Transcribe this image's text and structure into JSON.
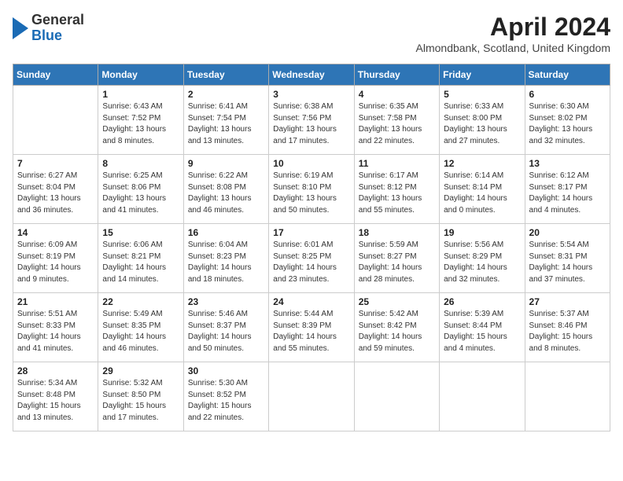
{
  "header": {
    "logo": {
      "line1": "General",
      "line2": "Blue"
    },
    "title": "April 2024",
    "location": "Almondbank, Scotland, United Kingdom"
  },
  "days_of_week": [
    "Sunday",
    "Monday",
    "Tuesday",
    "Wednesday",
    "Thursday",
    "Friday",
    "Saturday"
  ],
  "weeks": [
    [
      {
        "day": "",
        "sunrise": "",
        "sunset": "",
        "daylight": ""
      },
      {
        "day": "1",
        "sunrise": "6:43 AM",
        "sunset": "7:52 PM",
        "daylight": "13 hours and 8 minutes."
      },
      {
        "day": "2",
        "sunrise": "6:41 AM",
        "sunset": "7:54 PM",
        "daylight": "13 hours and 13 minutes."
      },
      {
        "day": "3",
        "sunrise": "6:38 AM",
        "sunset": "7:56 PM",
        "daylight": "13 hours and 17 minutes."
      },
      {
        "day": "4",
        "sunrise": "6:35 AM",
        "sunset": "7:58 PM",
        "daylight": "13 hours and 22 minutes."
      },
      {
        "day": "5",
        "sunrise": "6:33 AM",
        "sunset": "8:00 PM",
        "daylight": "13 hours and 27 minutes."
      },
      {
        "day": "6",
        "sunrise": "6:30 AM",
        "sunset": "8:02 PM",
        "daylight": "13 hours and 32 minutes."
      }
    ],
    [
      {
        "day": "7",
        "sunrise": "6:27 AM",
        "sunset": "8:04 PM",
        "daylight": "13 hours and 36 minutes."
      },
      {
        "day": "8",
        "sunrise": "6:25 AM",
        "sunset": "8:06 PM",
        "daylight": "13 hours and 41 minutes."
      },
      {
        "day": "9",
        "sunrise": "6:22 AM",
        "sunset": "8:08 PM",
        "daylight": "13 hours and 46 minutes."
      },
      {
        "day": "10",
        "sunrise": "6:19 AM",
        "sunset": "8:10 PM",
        "daylight": "13 hours and 50 minutes."
      },
      {
        "day": "11",
        "sunrise": "6:17 AM",
        "sunset": "8:12 PM",
        "daylight": "13 hours and 55 minutes."
      },
      {
        "day": "12",
        "sunrise": "6:14 AM",
        "sunset": "8:14 PM",
        "daylight": "14 hours and 0 minutes."
      },
      {
        "day": "13",
        "sunrise": "6:12 AM",
        "sunset": "8:17 PM",
        "daylight": "14 hours and 4 minutes."
      }
    ],
    [
      {
        "day": "14",
        "sunrise": "6:09 AM",
        "sunset": "8:19 PM",
        "daylight": "14 hours and 9 minutes."
      },
      {
        "day": "15",
        "sunrise": "6:06 AM",
        "sunset": "8:21 PM",
        "daylight": "14 hours and 14 minutes."
      },
      {
        "day": "16",
        "sunrise": "6:04 AM",
        "sunset": "8:23 PM",
        "daylight": "14 hours and 18 minutes."
      },
      {
        "day": "17",
        "sunrise": "6:01 AM",
        "sunset": "8:25 PM",
        "daylight": "14 hours and 23 minutes."
      },
      {
        "day": "18",
        "sunrise": "5:59 AM",
        "sunset": "8:27 PM",
        "daylight": "14 hours and 28 minutes."
      },
      {
        "day": "19",
        "sunrise": "5:56 AM",
        "sunset": "8:29 PM",
        "daylight": "14 hours and 32 minutes."
      },
      {
        "day": "20",
        "sunrise": "5:54 AM",
        "sunset": "8:31 PM",
        "daylight": "14 hours and 37 minutes."
      }
    ],
    [
      {
        "day": "21",
        "sunrise": "5:51 AM",
        "sunset": "8:33 PM",
        "daylight": "14 hours and 41 minutes."
      },
      {
        "day": "22",
        "sunrise": "5:49 AM",
        "sunset": "8:35 PM",
        "daylight": "14 hours and 46 minutes."
      },
      {
        "day": "23",
        "sunrise": "5:46 AM",
        "sunset": "8:37 PM",
        "daylight": "14 hours and 50 minutes."
      },
      {
        "day": "24",
        "sunrise": "5:44 AM",
        "sunset": "8:39 PM",
        "daylight": "14 hours and 55 minutes."
      },
      {
        "day": "25",
        "sunrise": "5:42 AM",
        "sunset": "8:42 PM",
        "daylight": "14 hours and 59 minutes."
      },
      {
        "day": "26",
        "sunrise": "5:39 AM",
        "sunset": "8:44 PM",
        "daylight": "15 hours and 4 minutes."
      },
      {
        "day": "27",
        "sunrise": "5:37 AM",
        "sunset": "8:46 PM",
        "daylight": "15 hours and 8 minutes."
      }
    ],
    [
      {
        "day": "28",
        "sunrise": "5:34 AM",
        "sunset": "8:48 PM",
        "daylight": "15 hours and 13 minutes."
      },
      {
        "day": "29",
        "sunrise": "5:32 AM",
        "sunset": "8:50 PM",
        "daylight": "15 hours and 17 minutes."
      },
      {
        "day": "30",
        "sunrise": "5:30 AM",
        "sunset": "8:52 PM",
        "daylight": "15 hours and 22 minutes."
      },
      {
        "day": "",
        "sunrise": "",
        "sunset": "",
        "daylight": ""
      },
      {
        "day": "",
        "sunrise": "",
        "sunset": "",
        "daylight": ""
      },
      {
        "day": "",
        "sunrise": "",
        "sunset": "",
        "daylight": ""
      },
      {
        "day": "",
        "sunrise": "",
        "sunset": "",
        "daylight": ""
      }
    ]
  ]
}
